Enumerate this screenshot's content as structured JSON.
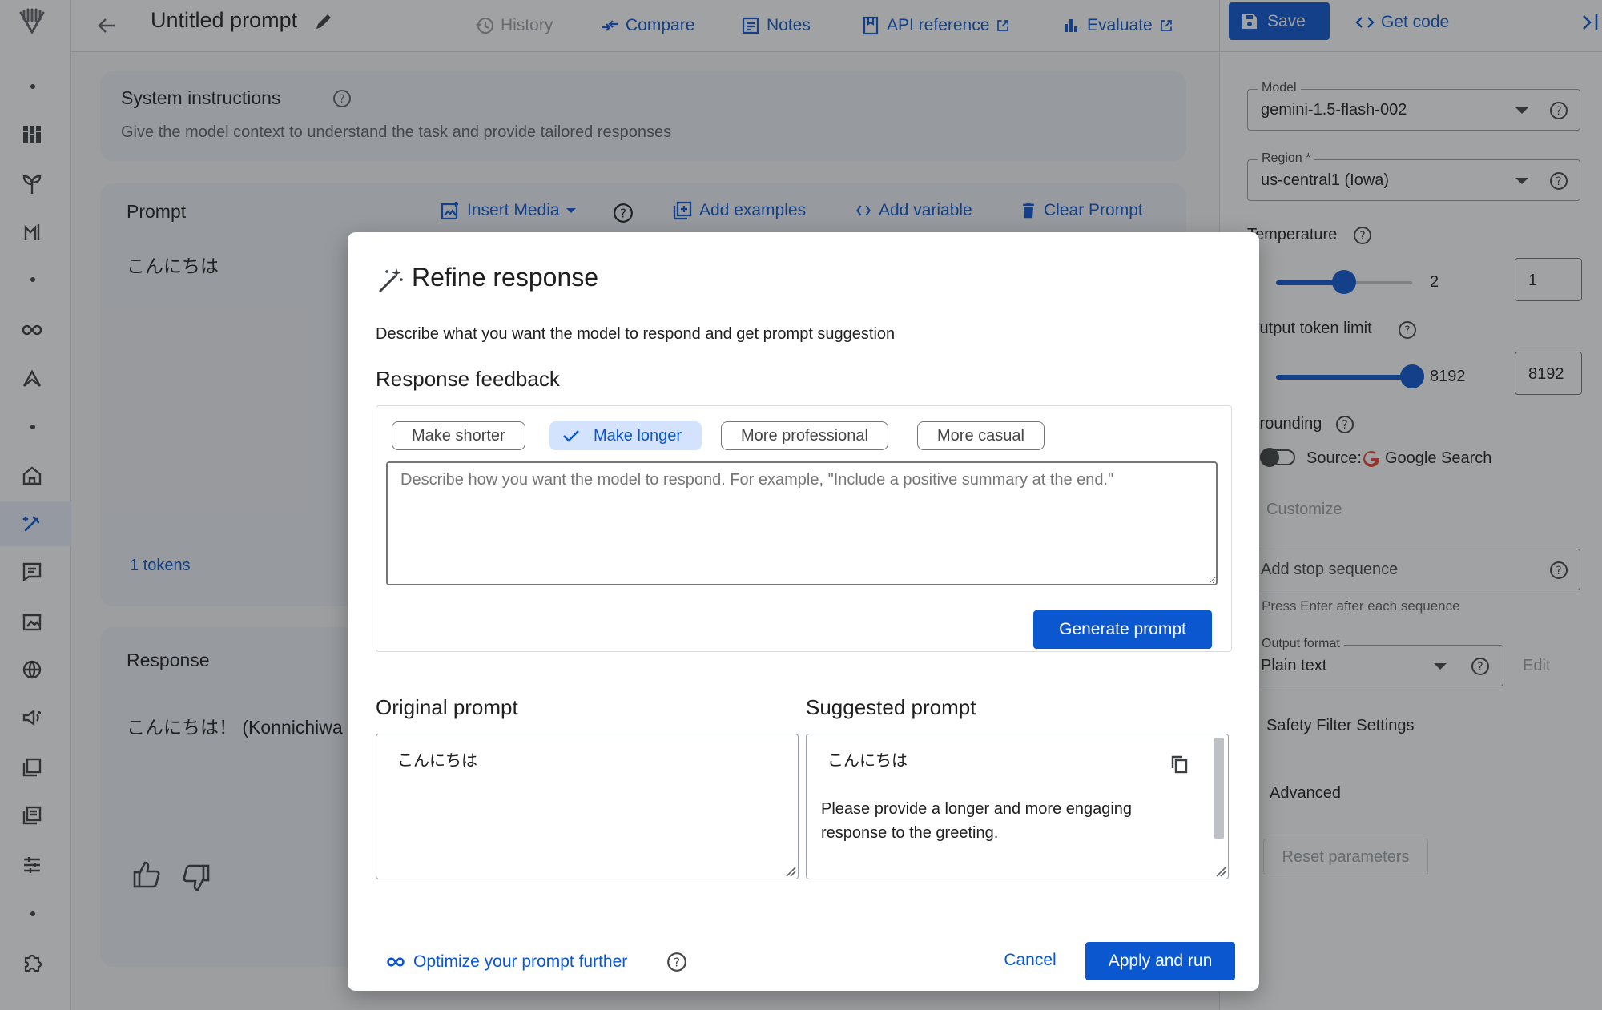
{
  "topbar": {
    "title": "Untitled prompt",
    "history_label": "History",
    "compare_label": "Compare",
    "notes_label": "Notes",
    "api_reference_label": "API reference",
    "evaluate_label": "Evaluate",
    "save_label": "Save",
    "get_code_label": "Get code"
  },
  "system_instructions": {
    "title": "System instructions",
    "placeholder": "Give the model context to understand the task and provide tailored responses"
  },
  "prompt": {
    "title": "Prompt",
    "insert_media_label": "Insert Media",
    "add_examples_label": "Add examples",
    "add_variable_label": "Add variable",
    "clear_prompt_label": "Clear Prompt",
    "text": "こんにちは",
    "tokens": "1 tokens"
  },
  "response": {
    "title": "Response",
    "text": "こんにちは！ (Konnichiwa"
  },
  "settings": {
    "model_label": "Model",
    "model_value": "gemini-1.5-flash-002",
    "region_label": "Region *",
    "region_value": "us-central1 (Iowa)",
    "temperature_label": "Temperature",
    "temperature_max": "2",
    "temperature_value": "1",
    "temperature_level": 0.5,
    "output_token_label": "Output token limit",
    "output_token_max": "8192",
    "output_token_value": "8192",
    "output_token_level": 1.0,
    "grounding_label": "Grounding",
    "source_label": "Source:",
    "source_value": "Google Search",
    "customize_label": "Customize",
    "stop_sequence_placeholder": "Add stop sequence",
    "stop_sequence_hint": "Press Enter after each sequence",
    "output_format_label": "Output format",
    "output_format_value": "Plain text",
    "edit_label": "Edit",
    "safety_label": "Safety Filter Settings",
    "advanced_label": "Advanced",
    "reset_label": "Reset parameters"
  },
  "dialog": {
    "title": "Refine response",
    "description": "Describe what you want the model to respond and get prompt suggestion",
    "feedback_title": "Response feedback",
    "chips": [
      {
        "label": "Make shorter",
        "selected": false
      },
      {
        "label": "Make longer",
        "selected": true
      },
      {
        "label": "More professional",
        "selected": false
      },
      {
        "label": "More casual",
        "selected": false
      }
    ],
    "feedback_placeholder": "Describe how you want the model to respond. For example, \"Include a positive summary at the end.\"",
    "generate_label": "Generate prompt",
    "original_title": "Original prompt",
    "original_text": "こんにちは",
    "suggested_title": "Suggested prompt",
    "suggested_line1": "こんにちは",
    "suggested_line2": "Please provide a longer and more engaging response to the greeting.",
    "optimize_label": "Optimize your prompt further",
    "cancel_label": "Cancel",
    "apply_label": "Apply and run"
  },
  "colors": {
    "accent": "#0b57d0",
    "chip_selected_bg": "#d3e3fd",
    "scrim": "#202124"
  }
}
